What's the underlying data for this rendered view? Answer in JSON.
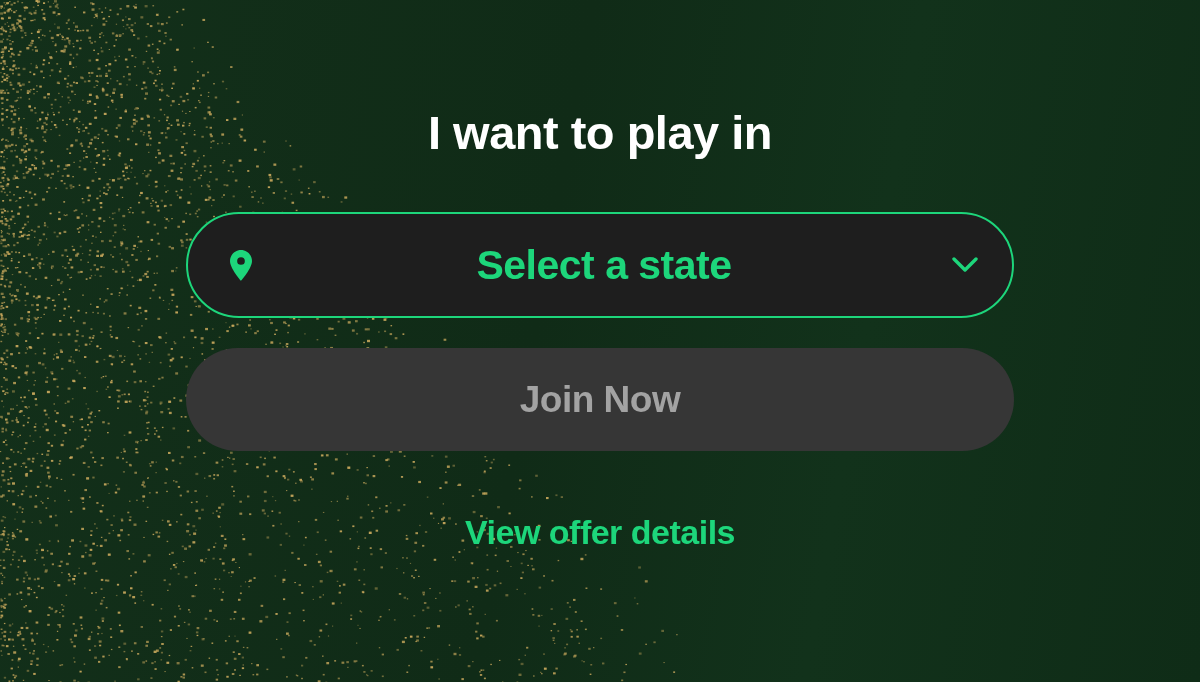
{
  "heading": "I want to play in",
  "state_select": {
    "placeholder": "Select a state"
  },
  "join_button": {
    "label": "Join Now",
    "disabled": true
  },
  "offer_link": {
    "label": "View offer details"
  }
}
